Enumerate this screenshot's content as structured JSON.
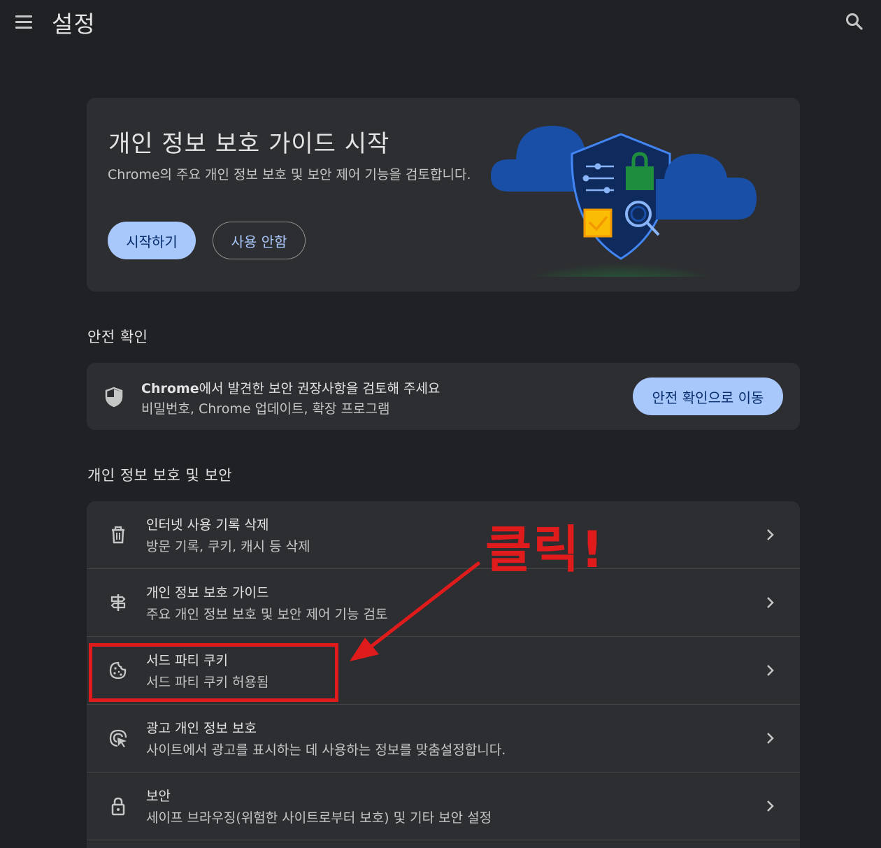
{
  "header": {
    "title": "설정",
    "menu_icon": "menu-icon",
    "search_icon": "search-icon"
  },
  "privacy_guide_card": {
    "title": "개인 정보 보호 가이드 시작",
    "description": "Chrome의 주요 개인 정보 보호 및 보안 제어 기능을 검토합니다.",
    "start_label": "시작하기",
    "decline_label": "사용 안함"
  },
  "safety_check": {
    "section_title": "안전 확인",
    "title_brand": "Chrome",
    "title_rest": "에서 발견한 보안 권장사항을 검토해 주세요",
    "subtitle": "비밀번호, Chrome 업데이트, 확장 프로그램",
    "button_label": "안전 확인으로 이동",
    "icon": "shield-icon"
  },
  "privacy_security": {
    "section_title": "개인 정보 보호 및 보안",
    "items": [
      {
        "title": "인터넷 사용 기록 삭제",
        "subtitle": "방문 기록, 쿠키, 캐시 등 삭제",
        "icon": "trash-icon"
      },
      {
        "title": "개인 정보 보호 가이드",
        "subtitle": "주요 개인 정보 보호 및 보안 제어 기능 검토",
        "icon": "signpost-icon"
      },
      {
        "title": "서드 파티 쿠키",
        "subtitle": "서드 파티 쿠키 허용됨",
        "icon": "cookie-icon"
      },
      {
        "title": "광고 개인 정보 보호",
        "subtitle": "사이트에서 광고를 표시하는 데 사용하는 정보를 맞춤설정합니다.",
        "icon": "ad-privacy-icon"
      },
      {
        "title": "보안",
        "subtitle": "세이프 브라우징(위험한 사이트로부터 보호) 및 기타 보안 설정",
        "icon": "lock-icon"
      }
    ]
  },
  "annotation": {
    "callout_text": "클릭!",
    "color": "#e01b1b"
  },
  "colors": {
    "background": "#202124",
    "card": "#2d2e31",
    "accent": "#a8c7fa",
    "accent_text": "#062e6f"
  }
}
